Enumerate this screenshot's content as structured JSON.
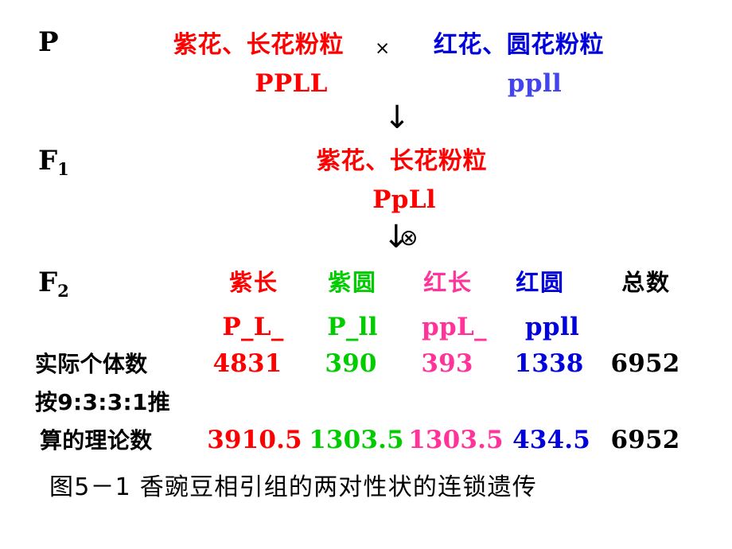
{
  "figure": {
    "caption": "图5－1  香豌豆相引组的两对性状的连锁遗传",
    "colors": {
      "purple_long": "#FF0000",
      "purple_round": "#00CC00",
      "red_long": "#FF3399",
      "red_round": "#0000DD",
      "total": "#000000",
      "symbol": "#000000"
    }
  },
  "parental": {
    "generation_label": "P",
    "generation_sub": "",
    "left_phenotype": "紫花、长花粉粒",
    "cross_symbol": "×",
    "right_phenotype": "红花、圆花粉粒",
    "left_genotype": "PPLL",
    "right_genotype": "ppll"
  },
  "arrow1": {
    "symbol": "↓"
  },
  "f1": {
    "generation_label": "F",
    "generation_sub": "1",
    "phenotype": "紫花、长花粉粒",
    "genotype": "PpLl"
  },
  "arrow2": {
    "arrow_symbol": "↓",
    "selfing_symbol": "⊗"
  },
  "f2": {
    "generation_label": "F",
    "generation_sub": "2",
    "phenotype_headers": [
      "紫长",
      "紫圆",
      "红长",
      "红圆",
      "总数"
    ],
    "genotype_headers": [
      "P_L_",
      "P_ll",
      "ppL_",
      "ppll",
      ""
    ],
    "rows": [
      {
        "label": "实际个体数",
        "values": [
          "4831",
          "390",
          "393",
          "1338",
          "6952"
        ]
      },
      {
        "label_line1": "按9:3:3:1推",
        "label_line2": "算的理论数",
        "values": [
          "3910.5",
          "1303.5",
          "1303.5",
          "434.5",
          "6952"
        ]
      }
    ]
  }
}
